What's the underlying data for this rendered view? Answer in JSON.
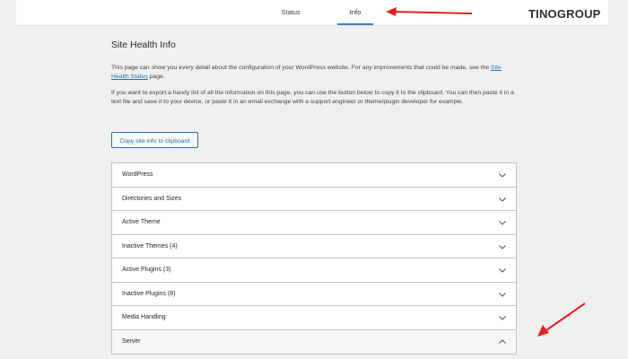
{
  "tabs": [
    {
      "label": "Status",
      "active": false
    },
    {
      "label": "Info",
      "active": true
    }
  ],
  "logo": {
    "text": "TINOGROUP",
    "accent_color": "#1fa24a"
  },
  "page": {
    "title": "Site Health Info",
    "p1_text": "This page can show you every detail about the configuration of your WordPress website. For any improvements that could be made, see the ",
    "p1_link": "Site Health Status",
    "p1_suffix": " page.",
    "p2_text": "If you want to export a handy list of all the information on this page, you can use the button below to copy it to the clipboard. You can then paste it in a text file and save it to your device, or paste it in an email exchange with a support engineer or theme/plugin developer for example.",
    "copy_button": "Copy site info to clipboard"
  },
  "sections": [
    {
      "label": "WordPress",
      "expanded": false
    },
    {
      "label": "Directories and Sizes",
      "expanded": false
    },
    {
      "label": "Active Theme",
      "expanded": false
    },
    {
      "label": "Inactive Themes (4)",
      "expanded": false
    },
    {
      "label": "Active Plugins (3)",
      "expanded": false
    },
    {
      "label": "Inactive Plugins (8)",
      "expanded": false
    },
    {
      "label": "Media Handling",
      "expanded": false
    },
    {
      "label": "Server",
      "expanded": true
    }
  ],
  "colors": {
    "accent": "#2271b1",
    "annotation_arrow": "#e02020"
  },
  "icons": {
    "collapsed": "chevron-down-icon",
    "expanded": "chevron-up-icon"
  }
}
